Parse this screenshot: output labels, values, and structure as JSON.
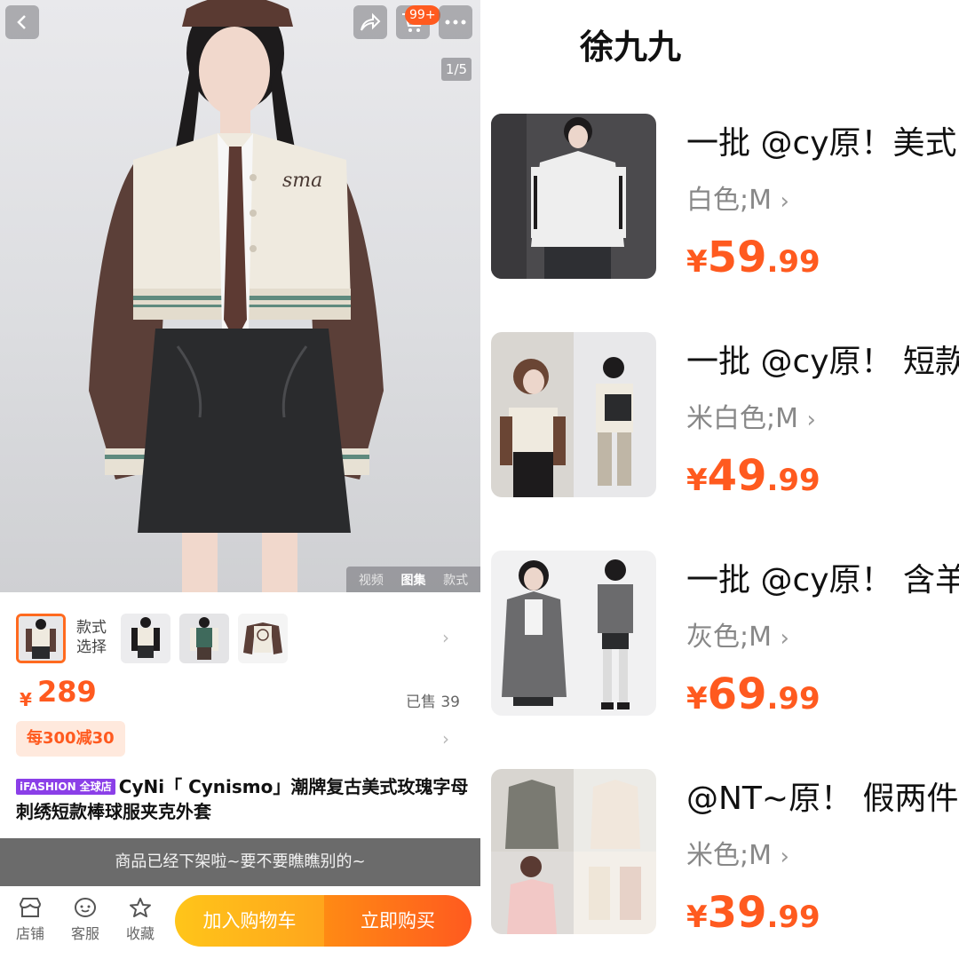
{
  "left": {
    "cart_badge": "99+",
    "image_counter": "1/5",
    "media_tabs": [
      "视频",
      "图集",
      "款式"
    ],
    "style_label": "款式\n选择",
    "price_symbol": "¥",
    "price": "289",
    "sold": "已售 39",
    "promo": "每300减30",
    "tag": "iFASHION 全球店",
    "title": "CyNi「 Cynismo」潮牌复古美式玫瑰字母刺绣短款棒球服夹克外套",
    "offline_notice": "商品已经下架啦~要不要瞧瞧别的~",
    "nav": [
      {
        "label": "店铺",
        "icon": "store-icon"
      },
      {
        "label": "客服",
        "icon": "customer-service-icon"
      },
      {
        "label": "收藏",
        "icon": "star-icon"
      }
    ],
    "add_to_cart": "加入购物车",
    "buy_now": "立即购买"
  },
  "right": {
    "shop_name": "徐九九",
    "items": [
      {
        "title": "一批 @cy原！美式",
        "variant": "白色;M",
        "price_symbol": "¥",
        "price_int": "59",
        "price_dec": ".99"
      },
      {
        "title": "一批 @cy原！ 短款",
        "variant": "米白色;M",
        "price_symbol": "¥",
        "price_int": "49",
        "price_dec": ".99"
      },
      {
        "title": "一批 @cy原！ 含羊",
        "variant": "灰色;M",
        "price_symbol": "¥",
        "price_int": "69",
        "price_dec": ".99"
      },
      {
        "title": "@NT~原！ 假两件",
        "variant": "米色;M",
        "price_symbol": "¥",
        "price_int": "39",
        "price_dec": ".99"
      }
    ]
  },
  "colors": {
    "accent": "#ff5a1f",
    "badge_purple": "#8b3fe8",
    "offline_bar": "#6b6b6b"
  }
}
